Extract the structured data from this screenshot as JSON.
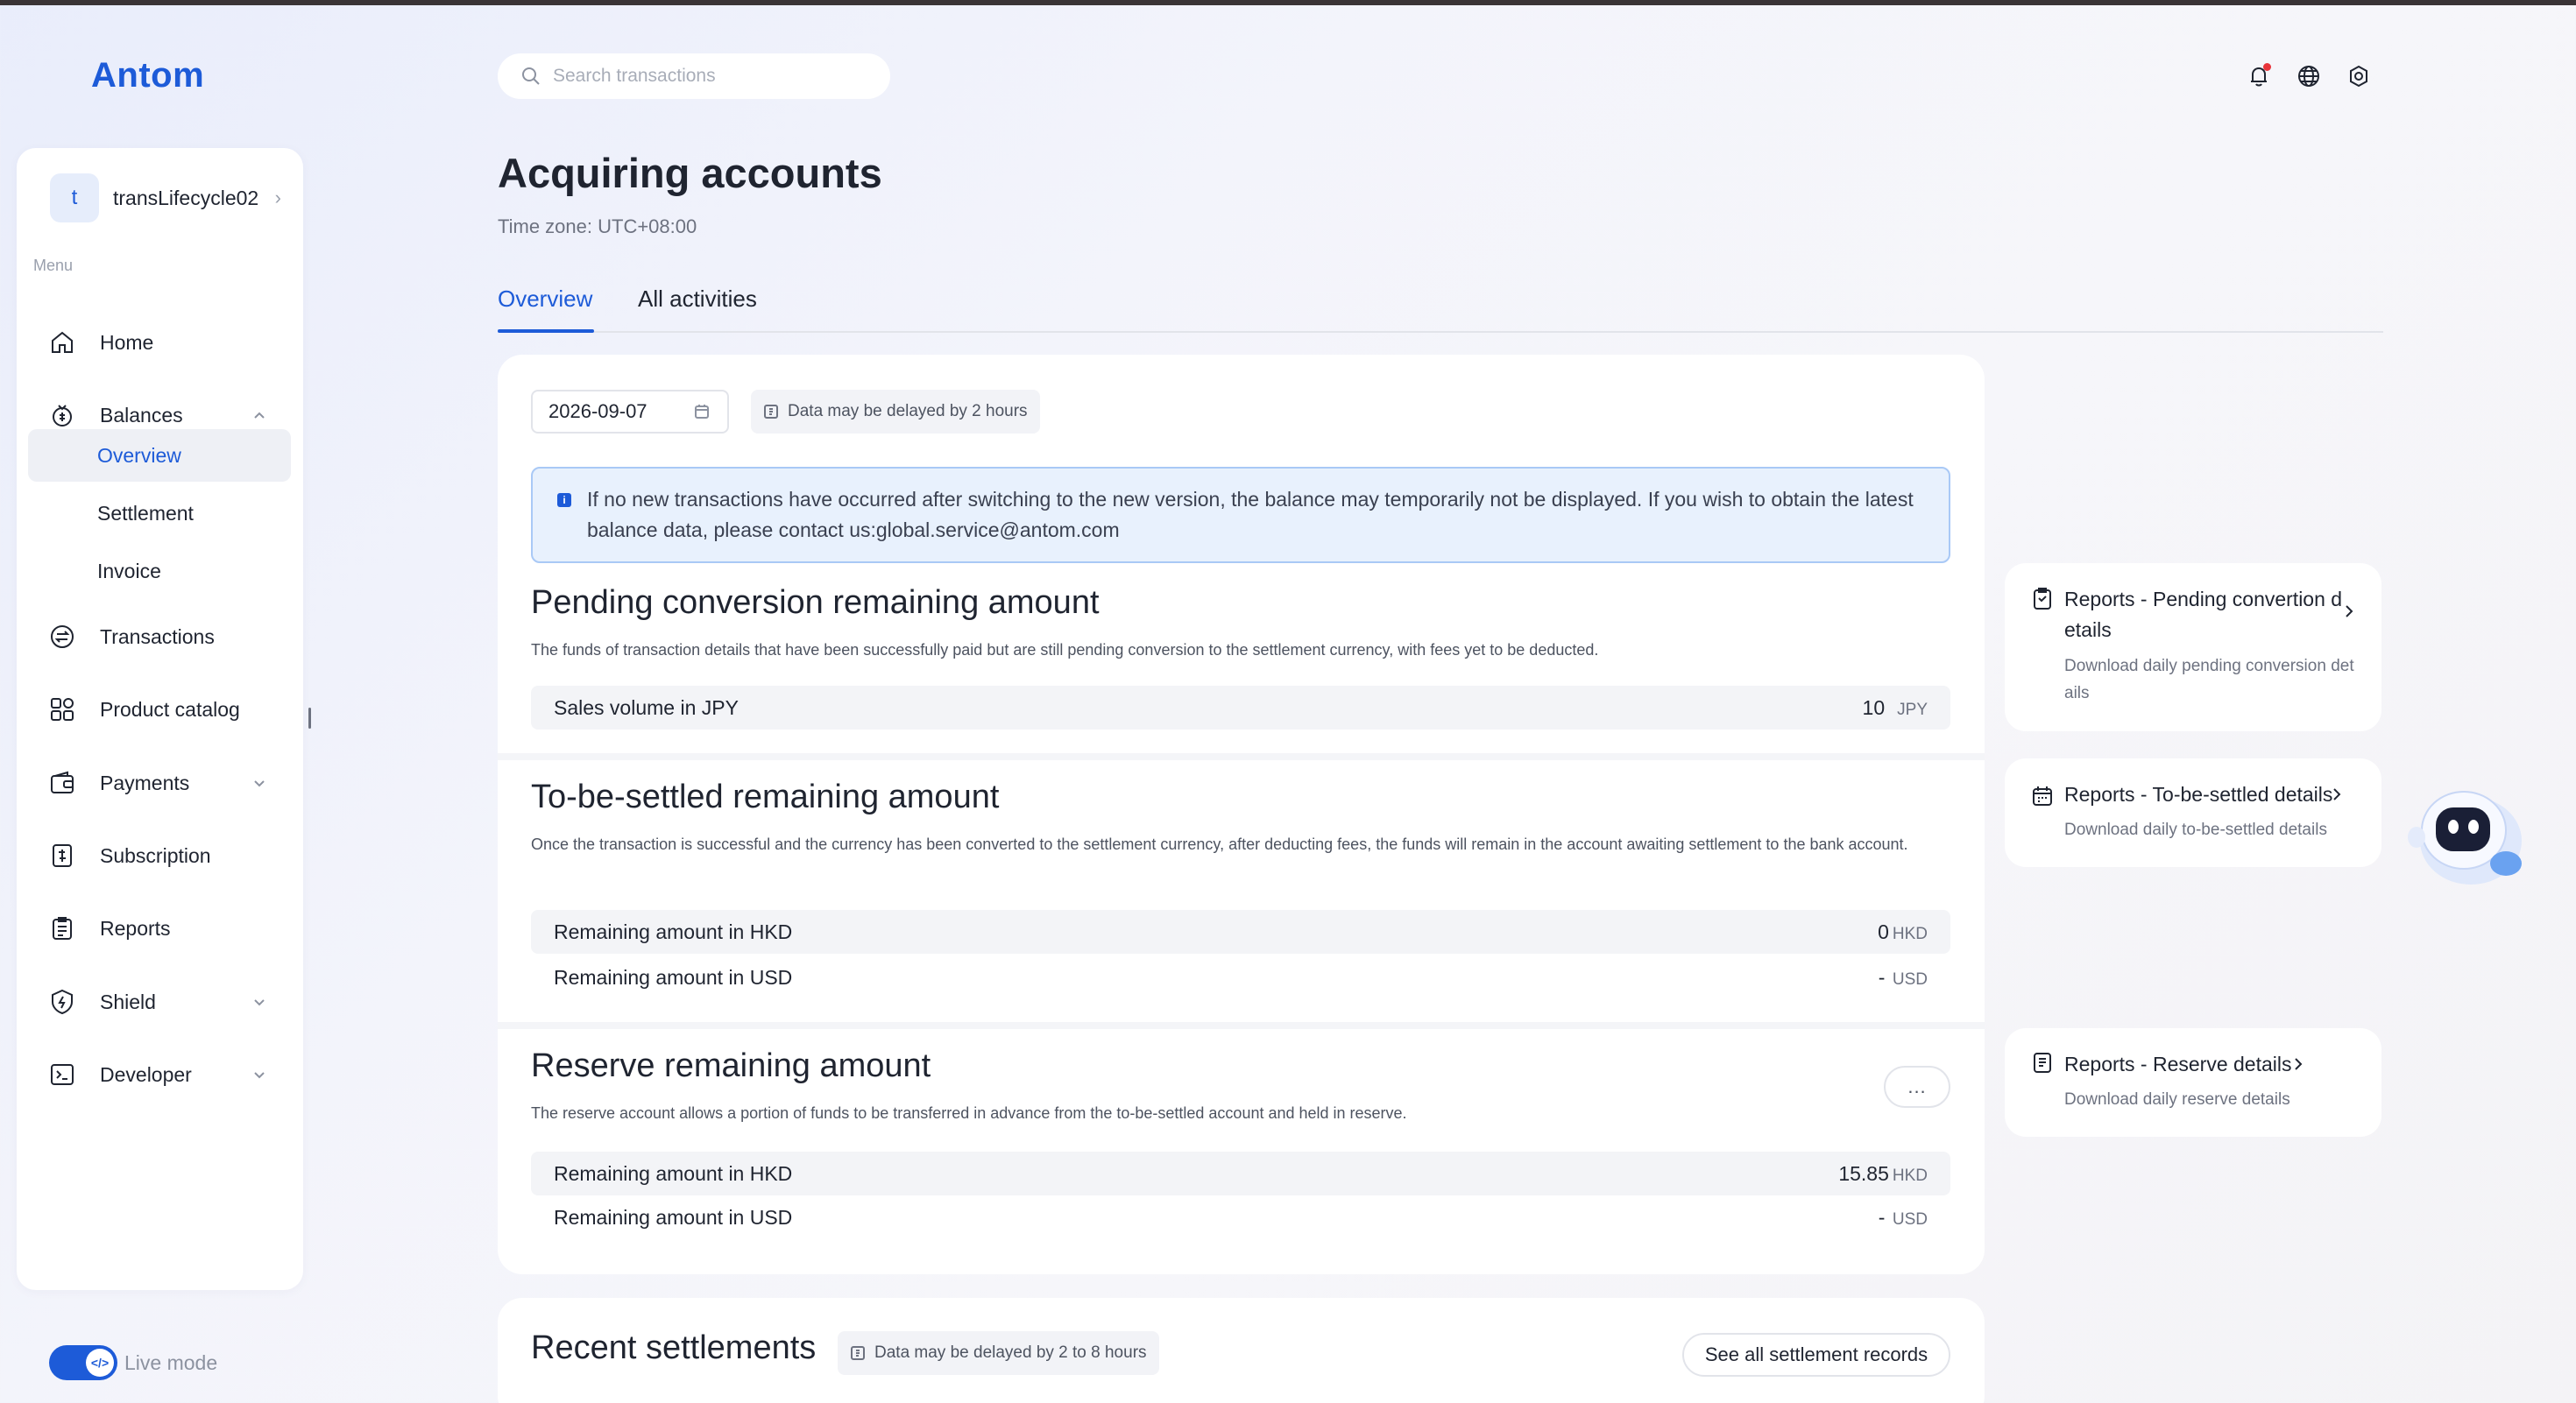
{
  "app": {
    "logo": "Antom"
  },
  "sidebar": {
    "account": {
      "initial": "t",
      "name": "transLifecycle02"
    },
    "menu_label": "Menu",
    "items": [
      {
        "label": "Home",
        "icon": "home-icon"
      },
      {
        "label": "Balances",
        "icon": "coin-icon",
        "expanded": true
      },
      {
        "label": "Transactions",
        "icon": "exchange-icon"
      },
      {
        "label": "Product catalog",
        "icon": "grid-icon"
      },
      {
        "label": "Payments",
        "icon": "wallet-icon",
        "expandable": true
      },
      {
        "label": "Subscription",
        "icon": "subscription-icon"
      },
      {
        "label": "Reports",
        "icon": "document-icon"
      },
      {
        "label": "Shield",
        "icon": "shield-icon",
        "expandable": true
      },
      {
        "label": "Developer",
        "icon": "terminal-icon",
        "expandable": true
      }
    ],
    "balances_sub": [
      "Overview",
      "Settlement",
      "Invoice"
    ],
    "live_mode": "Live mode"
  },
  "header": {
    "search_placeholder": "Search transactions",
    "icons": [
      "bell-icon",
      "globe-icon",
      "settings-icon"
    ]
  },
  "page": {
    "title": "Acquiring accounts",
    "timezone": "Time zone: UTC+08:00",
    "tabs": [
      "Overview",
      "All activities"
    ],
    "active_tab": "Overview"
  },
  "overview": {
    "date": "2026-09-07",
    "delay_note": "Data may be delayed by 2 hours",
    "notice": "If no new transactions have occurred after switching to the new version, the balance may temporarily not be displayed. If you wish to obtain the latest balance data, please contact us:global.service@antom.com",
    "pending": {
      "title": "Pending conversion remaining amount",
      "desc": "The funds of transaction details that have been successfully paid but are still pending conversion to the settlement currency, with fees yet to be deducted.",
      "rows": [
        {
          "label": "Sales volume in JPY",
          "value": "10",
          "currency": "JPY"
        }
      ]
    },
    "to_be_settled": {
      "title": "To-be-settled remaining amount",
      "desc": "Once the transaction is successful and the currency has been converted to the settlement currency, after deducting fees, the funds will remain in the account awaiting settlement to the bank account.",
      "rows": [
        {
          "label": "Remaining amount in HKD",
          "value": "0",
          "currency": "HKD"
        },
        {
          "label": "Remaining amount in USD",
          "value": "-",
          "currency": "USD"
        }
      ]
    },
    "reserve": {
      "title": "Reserve remaining amount",
      "desc": "The reserve account allows a portion of funds to be transferred in advance from the to-be-settled account and held in reserve.",
      "more": "...",
      "rows": [
        {
          "label": "Remaining amount in HKD",
          "value": "15.85",
          "currency": "HKD"
        },
        {
          "label": "Remaining amount in USD",
          "value": "-",
          "currency": "USD"
        }
      ]
    }
  },
  "reports": [
    {
      "title_line1": "Reports - Pending convertion d",
      "title_line2": "etails",
      "desc_line1": "Download daily pending conversion det",
      "desc_line2": "ails"
    },
    {
      "title": "Reports - To-be-settled details",
      "desc": "Download daily to-be-settled details"
    },
    {
      "title": "Reports - Reserve details",
      "desc": "Download daily reserve details"
    }
  ],
  "recent": {
    "title": "Recent settlements",
    "delay_note": "Data may be delayed by 2 to 8 hours",
    "see_all": "See all settlement records"
  },
  "colors": {
    "accent": "#1d5bd8",
    "notification": "#e8343a"
  }
}
